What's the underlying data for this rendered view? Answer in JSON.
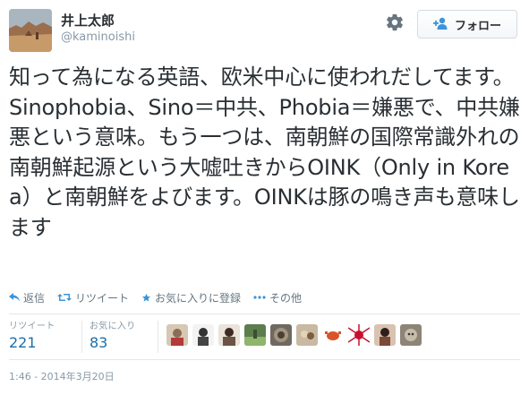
{
  "user": {
    "fullname": "井上太郎",
    "screen_name": "@kaminoishi"
  },
  "follow_label": "フォロー",
  "tweet_text": "知って為になる英語、欧米中心に使われだしてます。Sinophobia、Sino＝中共、Phobia＝嫌悪で、中共嫌悪という意味。もう一つは、南朝鮮の国際常識外れの南朝鮮起源という大嘘吐きからOINK（Only in Korea）と南朝鮮をよびます。OINKは豚の鳴き声も意味します",
  "actions": {
    "reply": "返信",
    "retweet": "リツイート",
    "favorite": "お気に入りに登録",
    "more": "その他"
  },
  "stats": {
    "retweets_label": "リツイート",
    "retweets": "221",
    "favorites_label": "お気に入り",
    "favorites": "83"
  },
  "timestamp": "1:46 - 2014年3月20日",
  "colors": {
    "link": "#1c6ea8",
    "muted": "#8899a6",
    "text": "#292f33",
    "action_icon": "#3b94d9"
  },
  "icons": {
    "gear": "gear-icon",
    "follow": "add-user-icon",
    "reply": "reply-icon",
    "retweet": "retweet-icon",
    "favorite": "star-icon",
    "more": "more-dots-icon"
  }
}
